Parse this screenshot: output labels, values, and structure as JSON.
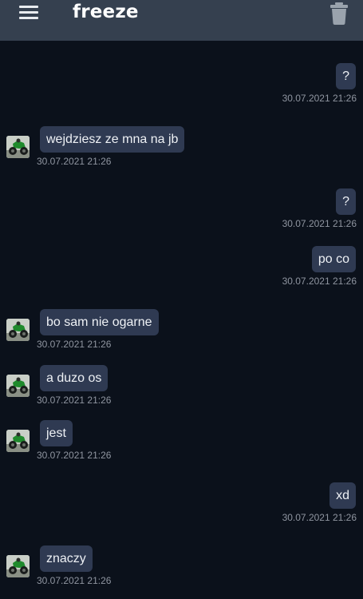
{
  "header": {
    "title": "freeze",
    "menu_icon": "hamburger-menu-icon",
    "delete_icon": "trash-icon"
  },
  "messages": [
    {
      "direction": "out",
      "text": "?",
      "time": "30.07.2021 21:26"
    },
    {
      "direction": "in",
      "text": "wejdziesz ze mna na jb",
      "time": "30.07.2021 21:26"
    },
    {
      "direction": "out",
      "text": "?",
      "time": "30.07.2021 21:26"
    },
    {
      "direction": "out",
      "text": "po co",
      "time": "30.07.2021 21:26"
    },
    {
      "direction": "in",
      "text": "bo sam nie ogarne",
      "time": "30.07.2021 21:26"
    },
    {
      "direction": "in",
      "text": "a duzo os",
      "time": "30.07.2021 21:26"
    },
    {
      "direction": "in",
      "text": "jest",
      "time": "30.07.2021 21:26"
    },
    {
      "direction": "out",
      "text": "xd",
      "time": "30.07.2021 21:26"
    },
    {
      "direction": "in",
      "text": "znaczy",
      "time": "30.07.2021 21:26"
    }
  ],
  "colors": {
    "background": "#0b111b",
    "header": "#35404f",
    "bubble": "#2f3a52",
    "timestamp": "#8f95a0"
  }
}
